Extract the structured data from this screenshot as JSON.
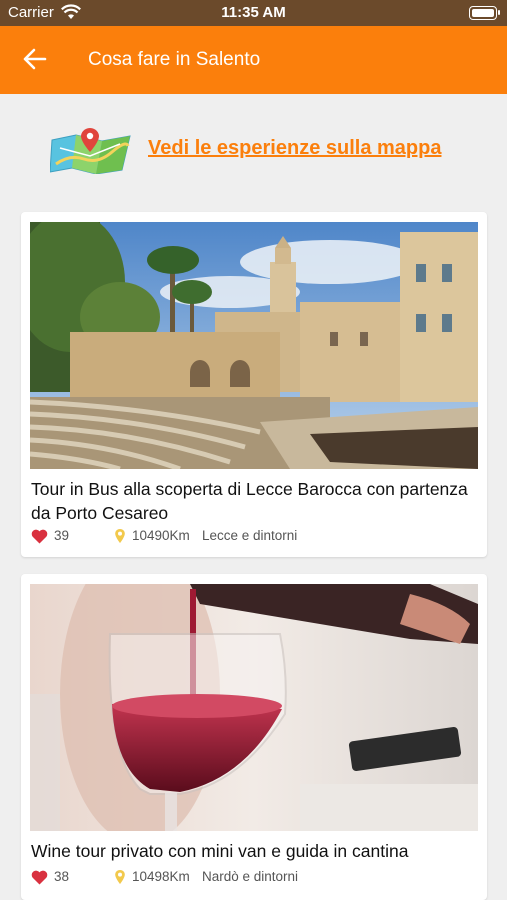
{
  "status_bar": {
    "carrier": "Carrier",
    "time": "11:35 AM"
  },
  "nav": {
    "title": "Cosa fare in Salento",
    "back_icon": "arrow-left-icon"
  },
  "map_link": {
    "label": "Vedi le esperienze sulla mappa",
    "icon": "map-icon"
  },
  "colors": {
    "accent": "#fb7f0c",
    "heart": "#d9313f",
    "pin": "#f2c94c"
  },
  "experiences": [
    {
      "title": "Tour in Bus alla scoperta di Lecce Barocca con partenza da Porto Cesareo",
      "likes": "39",
      "distance": "10490Km",
      "area": "Lecce e dintorni",
      "image": "lecce-roman-amphitheatre-photo"
    },
    {
      "title": "Wine tour privato con mini van e guida in cantina",
      "likes": "38",
      "distance": "10498Km",
      "area": "Nardò e dintorni",
      "image": "red-wine-glass-photo"
    }
  ]
}
